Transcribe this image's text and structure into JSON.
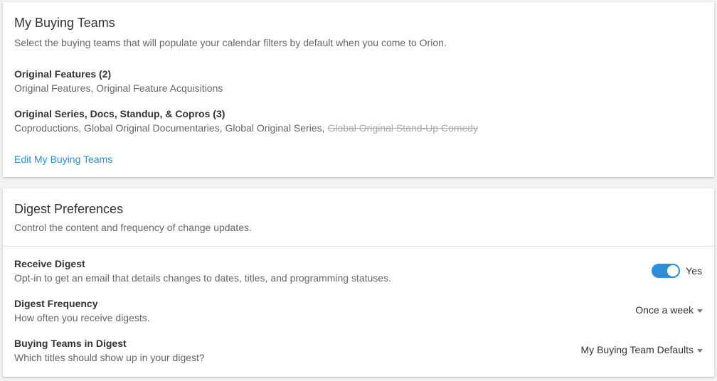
{
  "buying_teams": {
    "title": "My Buying Teams",
    "subtitle": "Select the buying teams that will populate your calendar filters by default when you come to Orion.",
    "groups": [
      {
        "title": "Original Features (2)",
        "items": "Original Features, Original Feature Acquisitions"
      },
      {
        "title": "Original Series, Docs, Standup, & Copros (3)",
        "items": "Coproductions, Global Original Documentaries, Global Original Series,",
        "struck_item": "Global Original Stand-Up Comedy"
      }
    ],
    "edit_link": "Edit My Buying Teams"
  },
  "digest": {
    "title": "Digest Preferences",
    "subtitle": "Control the content and frequency of change updates.",
    "rows": [
      {
        "title": "Receive Digest",
        "desc": "Opt-in to get an email that details changes to dates, titles, and programming statuses.",
        "control": "toggle",
        "value": "Yes",
        "enabled": true
      },
      {
        "title": "Digest Frequency",
        "desc": "How often you receive digests.",
        "control": "dropdown",
        "value": "Once a week"
      },
      {
        "title": "Buying Teams in Digest",
        "desc": "Which titles should show up in your digest?",
        "control": "dropdown",
        "value": "My Buying Team Defaults"
      }
    ]
  },
  "colors": {
    "accent": "#2a8fd6",
    "strike": "#aaaaaa"
  }
}
